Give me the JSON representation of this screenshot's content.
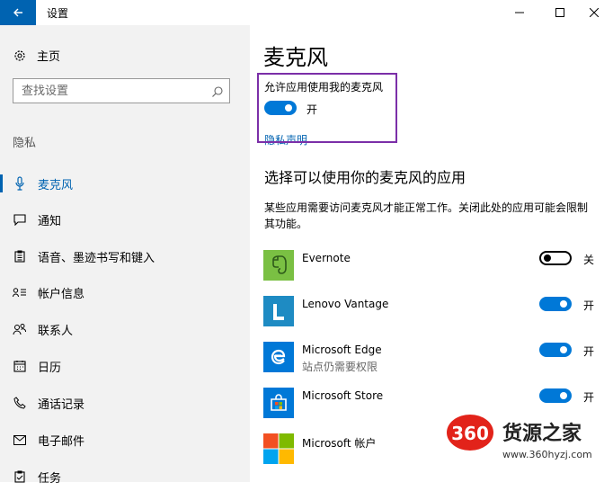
{
  "window": {
    "title": "设置"
  },
  "sidebar": {
    "home_label": "主页",
    "search_placeholder": "查找设置",
    "section_label": "隐私",
    "items": [
      {
        "label": "麦克风",
        "icon": "microphone-icon",
        "active": true
      },
      {
        "label": "通知",
        "icon": "chat-bubble-icon"
      },
      {
        "label": "语音、墨迹书写和键入",
        "icon": "clipboard-icon"
      },
      {
        "label": "帐户信息",
        "icon": "account-info-icon"
      },
      {
        "label": "联系人",
        "icon": "contacts-icon"
      },
      {
        "label": "日历",
        "icon": "calendar-icon"
      },
      {
        "label": "通话记录",
        "icon": "call-history-icon"
      },
      {
        "label": "电子邮件",
        "icon": "mail-icon"
      },
      {
        "label": "任务",
        "icon": "tasks-icon"
      }
    ]
  },
  "main": {
    "title": "麦克风",
    "allow_label": "允许应用使用我的麦克风",
    "allow_state": "开",
    "privacy_link": "隐私声明",
    "section_heading": "选择可以使用你的麦克风的应用",
    "description": "某些应用需要访问麦克风才能正常工作。关闭此处的应用可能会限制其功能。",
    "apps": [
      {
        "name": "Evernote",
        "state": "关",
        "on": false
      },
      {
        "name": "Lenovo Vantage",
        "state": "开",
        "on": true
      },
      {
        "name": "Microsoft Edge",
        "sub": "站点仍需要权限",
        "state": "开",
        "on": true
      },
      {
        "name": "Microsoft Store",
        "state": "开",
        "on": true
      },
      {
        "name": "Microsoft 帐户"
      }
    ]
  },
  "watermark": {
    "number": "360",
    "text": "货源之家",
    "url": "www.360hyzj.com"
  },
  "colors": {
    "accent": "#0078d7",
    "link": "#0063b1",
    "highlight_border": "#7b2fa8",
    "watermark_red": "#e2231a"
  }
}
